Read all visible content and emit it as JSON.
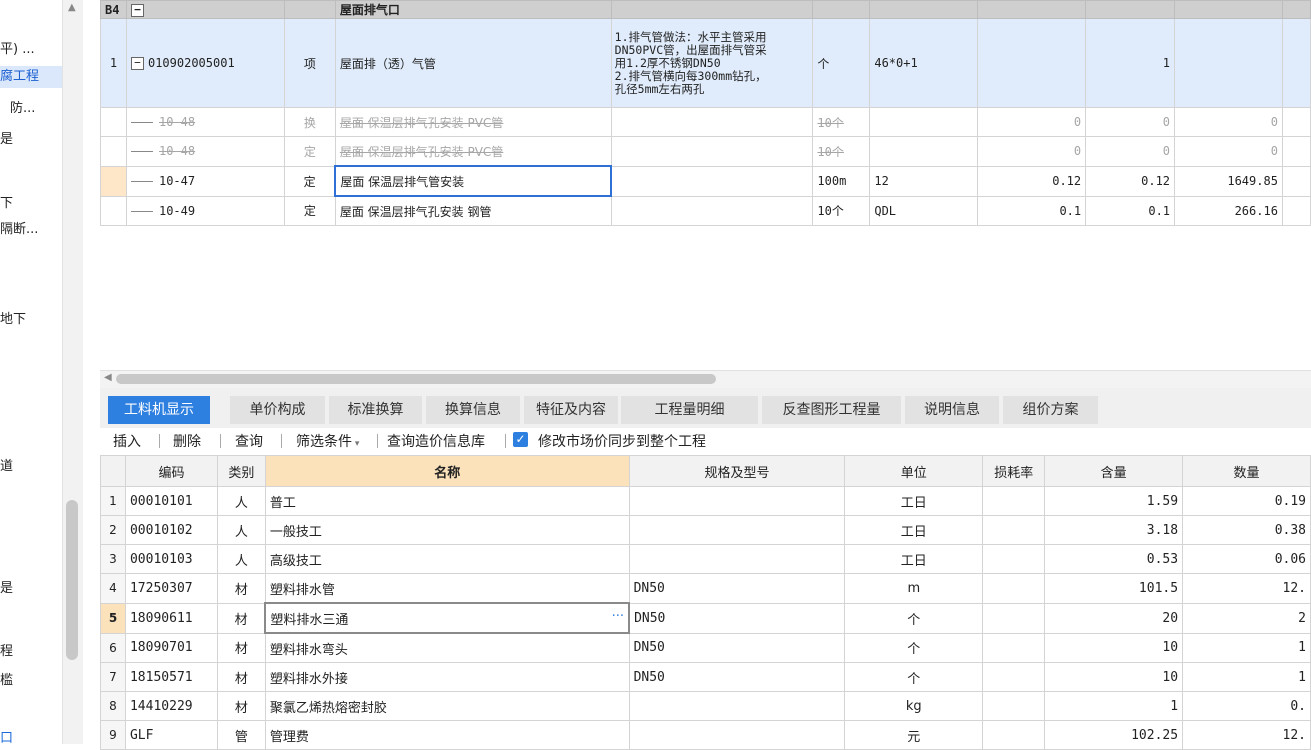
{
  "left_tree": {
    "nodes": [
      {
        "label": "平) ...",
        "style": "normal"
      },
      {
        "label": "腐工程",
        "style": "sel"
      },
      {
        "label": "防...",
        "style": "normal"
      },
      {
        "label": "是",
        "style": "normal"
      },
      {
        "label": "下",
        "style": "normal"
      },
      {
        "label": "隔断...",
        "style": "normal"
      },
      {
        "label": "地下",
        "style": "normal"
      },
      {
        "label": "道",
        "style": "normal"
      },
      {
        "label": "是",
        "style": "normal"
      },
      {
        "label": "程",
        "style": "normal"
      },
      {
        "label": "槛",
        "style": "normal"
      },
      {
        "label": "口",
        "style": "link"
      }
    ]
  },
  "upper_grid": {
    "header_row": {
      "code": "B4",
      "name": "屋面排气口"
    },
    "main_row": {
      "index": "1",
      "code": "010902005001",
      "type": "项",
      "name": "屋面排（透）气管",
      "feature_lines": [
        "1.排气管做法：水平主管采用",
        "DN50PVC管，出屋面排气管采",
        "用1.2厚不锈钢DN50",
        "2.排气管横向每300mm钻孔，",
        "孔径5mm左右两孔"
      ],
      "unit": "个",
      "expr": "46*0+1",
      "col9": "",
      "qty": "1",
      "price": ""
    },
    "sub_rows": [
      {
        "code": "10-48",
        "type": "换",
        "name": "屋面 保温层排气孔安装 PVC管",
        "unit": "10个",
        "expr": "",
        "c1": "0",
        "c2": "0",
        "c3": "0",
        "strike": true
      },
      {
        "code": "10-48",
        "type": "定",
        "name": "屋面 保温层排气孔安装 PVC管",
        "unit": "10个",
        "expr": "",
        "c1": "0",
        "c2": "0",
        "c3": "0",
        "strike": true
      },
      {
        "code": "10-47",
        "type": "定",
        "name": "屋面 保温层排气管安装",
        "unit": "100m",
        "expr": "12",
        "c1": "0.12",
        "c2": "0.12",
        "c3": "1649.85",
        "strike": false
      },
      {
        "code": "10-49",
        "type": "定",
        "name": "屋面 保温层排气孔安装 钢管",
        "unit": "10个",
        "expr": "QDL",
        "c1": "0.1",
        "c2": "0.1",
        "c3": "266.16",
        "strike": false
      }
    ]
  },
  "tabs": [
    "工料机显示",
    "单价构成",
    "标准换算",
    "换算信息",
    "特征及内容",
    "工程量明细",
    "反查图形工程量",
    "说明信息",
    "组价方案"
  ],
  "toolbar": {
    "insert": "插入",
    "delete": "删除",
    "query": "查询",
    "filter": "筛选条件",
    "query_price_db": "查询造价信息库",
    "sync_label": "修改市场价同步到整个工程"
  },
  "lower_grid": {
    "headers": {
      "code": "编码",
      "category": "类别",
      "name": "名称",
      "spec": "规格及型号",
      "unit": "单位",
      "loss": "损耗率",
      "content": "含量",
      "qty": "数量"
    },
    "rows": [
      {
        "n": "1",
        "code": "00010101",
        "cat": "人",
        "name": "普工",
        "spec": "",
        "unit": "工日",
        "loss": "",
        "content": "1.59",
        "qty": "0.19"
      },
      {
        "n": "2",
        "code": "00010102",
        "cat": "人",
        "name": "一般技工",
        "spec": "",
        "unit": "工日",
        "loss": "",
        "content": "3.18",
        "qty": "0.38"
      },
      {
        "n": "3",
        "code": "00010103",
        "cat": "人",
        "name": "高级技工",
        "spec": "",
        "unit": "工日",
        "loss": "",
        "content": "0.53",
        "qty": "0.06"
      },
      {
        "n": "4",
        "code": "17250307",
        "cat": "材",
        "name": "塑料排水管",
        "spec": "DN50",
        "unit": "m",
        "loss": "",
        "content": "101.5",
        "qty": "12."
      },
      {
        "n": "5",
        "code": "18090611",
        "cat": "材",
        "name": "塑料排水三通",
        "spec": "DN50",
        "unit": "个",
        "loss": "",
        "content": "20",
        "qty": "2"
      },
      {
        "n": "6",
        "code": "18090701",
        "cat": "材",
        "name": "塑料排水弯头",
        "spec": "DN50",
        "unit": "个",
        "loss": "",
        "content": "10",
        "qty": "1"
      },
      {
        "n": "7",
        "code": "18150571",
        "cat": "材",
        "name": "塑料排水外接",
        "spec": "DN50",
        "unit": "个",
        "loss": "",
        "content": "10",
        "qty": "1"
      },
      {
        "n": "8",
        "code": "14410229",
        "cat": "材",
        "name": "聚氯乙烯热熔密封胶",
        "spec": "",
        "unit": "kg",
        "loss": "",
        "content": "1",
        "qty": "0."
      },
      {
        "n": "9",
        "code": "GLF",
        "cat": "管",
        "name": "管理费",
        "spec": "",
        "unit": "元",
        "loss": "",
        "content": "102.25",
        "qty": "12."
      }
    ]
  },
  "colors": {
    "accent": "#2d7fe0",
    "selected_row": "#e0ecfb",
    "name_header": "#fbe2bb"
  }
}
